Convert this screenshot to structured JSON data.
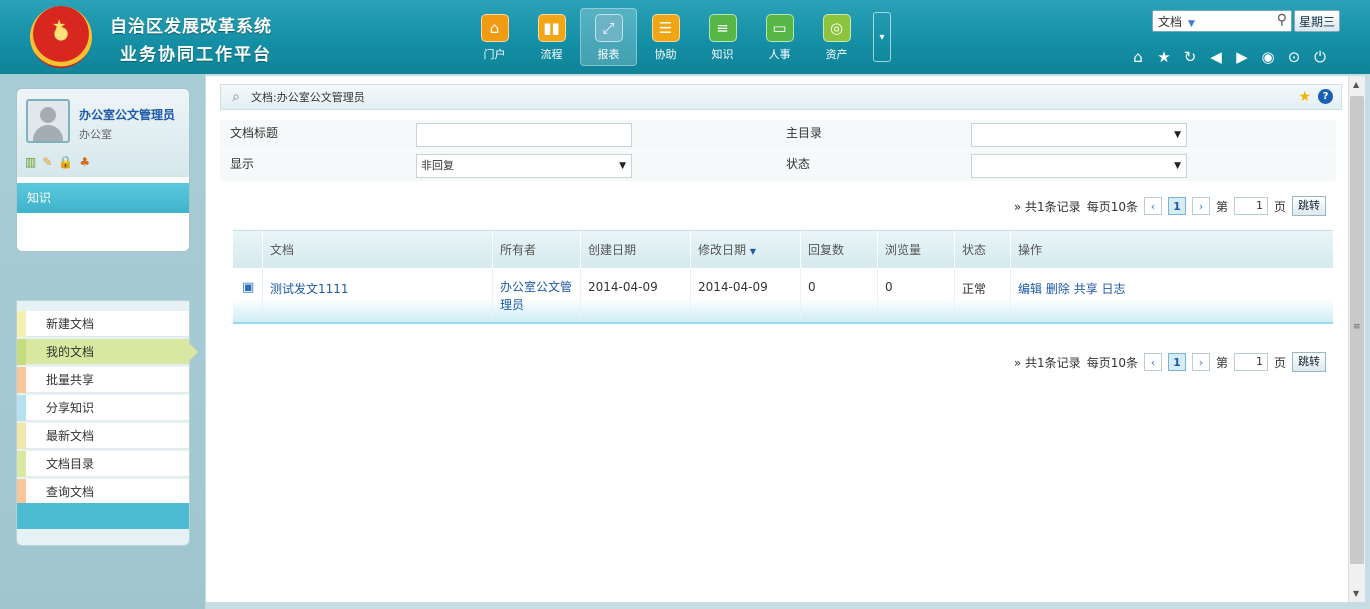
{
  "header": {
    "title_line1": "自治区发展改革系统",
    "title_line2": "业务协同工作平台",
    "nav": [
      {
        "label": "门户",
        "icon": "home-icon",
        "color": "#f29a12"
      },
      {
        "label": "流程",
        "icon": "chart-icon",
        "color": "#f0a514"
      },
      {
        "label": "报表",
        "icon": "report-icon",
        "color": "#6db3c6",
        "active": true
      },
      {
        "label": "协助",
        "icon": "clipboard-icon",
        "color": "#f0a514"
      },
      {
        "label": "知识",
        "icon": "server-icon",
        "color": "#57b746"
      },
      {
        "label": "人事",
        "icon": "window-icon",
        "color": "#57b746"
      },
      {
        "label": "资产",
        "icon": "coins-icon",
        "color": "#8dc43e"
      }
    ],
    "search_scope": "文档",
    "weekday": "星期三"
  },
  "user": {
    "name": "办公室公文管理员",
    "dept": "办公室"
  },
  "sidebar": {
    "section": "知识",
    "items": [
      {
        "label": "新建文档",
        "color": "#f7f0b0"
      },
      {
        "label": "我的文档",
        "color": "#d9e8a0",
        "active": true
      },
      {
        "label": "批量共享",
        "color": "#f7c79a"
      },
      {
        "label": "分享知识",
        "color": "#b7e0ef"
      },
      {
        "label": "最新文档",
        "color": "#f0e6a8"
      },
      {
        "label": "文档目录",
        "color": "#d9e8a0"
      },
      {
        "label": "查询文档",
        "color": "#f7c79a"
      }
    ]
  },
  "breadcrumb": "文档:办公室公文管理员",
  "form": {
    "title_label": "文档标题",
    "title_value": "",
    "catalog_label": "主目录",
    "catalog_value": "",
    "display_label": "显示",
    "display_value": "非回复",
    "status_label": "状态",
    "status_value": ""
  },
  "pager": {
    "summary": "» 共1条记录",
    "per_page": "每页10条",
    "current": "1",
    "page_prefix": "第",
    "page_input": "1",
    "page_suffix": "页",
    "go": "跳转"
  },
  "table": {
    "headers": [
      "文档",
      "所有者",
      "创建日期",
      "修改日期",
      "回复数",
      "浏览量",
      "状态",
      "操作"
    ],
    "sort_indicator": "▼",
    "rows": [
      {
        "title": "测试发文1111",
        "owner": "办公室公文管理员",
        "created": "2014-04-09",
        "modified": "2014-04-09",
        "replies": "0",
        "views": "0",
        "status": "正常",
        "actions": [
          "编辑",
          "删除",
          "共享",
          "日志"
        ]
      }
    ]
  }
}
